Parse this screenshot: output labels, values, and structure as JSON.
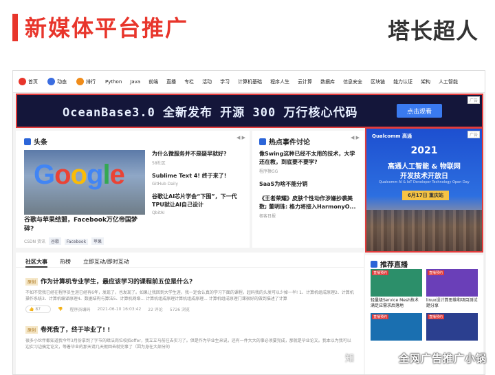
{
  "slide": {
    "title": "新媒体平台推广",
    "brand": "塔长超人",
    "watermark": "全网广告推广小锅",
    "wm_prefix": "知"
  },
  "nav": {
    "top_items": [
      {
        "label": "首页",
        "color": "#e8352b"
      },
      {
        "label": "动态",
        "color": "#3b6de0"
      },
      {
        "label": "排行",
        "color": "#f08c1a"
      }
    ],
    "items": [
      "Python",
      "Java",
      "前端",
      "直播",
      "专栏",
      "活动",
      "学习",
      "计算机基础",
      "程序人生",
      "云计算",
      "数据库",
      "信息安全",
      "区块链",
      "能力认证",
      "架构",
      "人工智能"
    ]
  },
  "banner": {
    "headline": "OceanBase3.0 全新发布  开源 300 万行核心代码",
    "cta": "点击观看",
    "ad_tag": "广告"
  },
  "headlines": {
    "title": "头条",
    "hero_caption": "谷歌与苹果结盟，Facebook万亿帝国梦碎?",
    "hero_source": "CSDN 资讯",
    "hero_tags": [
      "谷歌",
      "Facebook",
      "苹果"
    ],
    "list": [
      {
        "title": "为什么微服务并不是疑早就好?",
        "source": "58社区"
      },
      {
        "title": "Sublime Text 4! 终于来了!",
        "source": "GitHub Daily"
      },
      {
        "title": "谷歌让AI芯片学会“下围”，下一代TPU就让AI自己设计",
        "source": "QbitAI"
      }
    ]
  },
  "hot": {
    "title": "热点事件讨论",
    "list": [
      {
        "title": "像Swing这种已经不太用的技术，大学还在教，到底要不要学?",
        "source": "程序猿GG"
      },
      {
        "title": "SaaS为啥不能分销",
        "source": ""
      },
      {
        "title": "《王者荣耀》皮肤个性动作涉嫌抄袭美数; 董明珠: 格力将接入HarmonyO...",
        "source": "极客日报"
      }
    ]
  },
  "qualcomm_ad": {
    "brand": "Qualcomm 高通",
    "year": "2021",
    "line1": "高通人工智能 & 物联网",
    "line2": "开发技术开放日",
    "sub": "Qualcomm AI & IoT Developer Technology Open Day",
    "date": "6月17日 重庆站",
    "ad_tag": "广告"
  },
  "feed": {
    "tabs": [
      "社区大事",
      "热榜",
      "立即互动/即时互动"
    ],
    "posts": [
      {
        "badge": "原创",
        "title": "作为计算机专业学生，最应该学习的课程前五位是什么?",
        "excerpt": "不如不觉我已经在程序员生涯已经有6年，发现了，也发现了。如果让我回到大学生涯，我一定会认真的学习下面的课程。起码我的头发可以少掉一半! 1、计算机组成原理2、计算机操作系统3、计算机编译原理4、数据结构与算法5、计算机网络... 计算机组成原理计算机组成原理... 计算机组成原理门课很好的做到描述了计算",
        "likes": "87",
        "author": "程序员编码",
        "time": "2021-06-10 16:03:42",
        "comments": "22 评论",
        "views": "5726 浏览"
      },
      {
        "badge": "原创",
        "title": "卷死我了，终于毕业了! !",
        "excerpt": "很多小伙伴都知道我今年3月份拿到了字节的暗法岗位校招offer，我立立马前往去实习了。但是作为毕业生来说，还有一件大大的事必须要完成，那就是毕业论文。我本以为我可以边实习边搞定论文，等着毕业的那天请几天假回去就完事了（因为身在大部分的"
      }
    ]
  },
  "live": {
    "title": "推荐直播",
    "items": [
      {
        "label": "直播预约",
        "caption": "轻量级Service Mesh技术满足应需求后落地",
        "color": "#2c8f6a"
      },
      {
        "label": "直播预约",
        "caption": "linux设计算思维和项目测试题分享",
        "color": "#6a3fb8"
      },
      {
        "label": "直播预约",
        "caption": "",
        "color": "#1a6fb0"
      },
      {
        "label": "直播预约",
        "caption": "",
        "color": "#2b3f8f"
      }
    ]
  }
}
